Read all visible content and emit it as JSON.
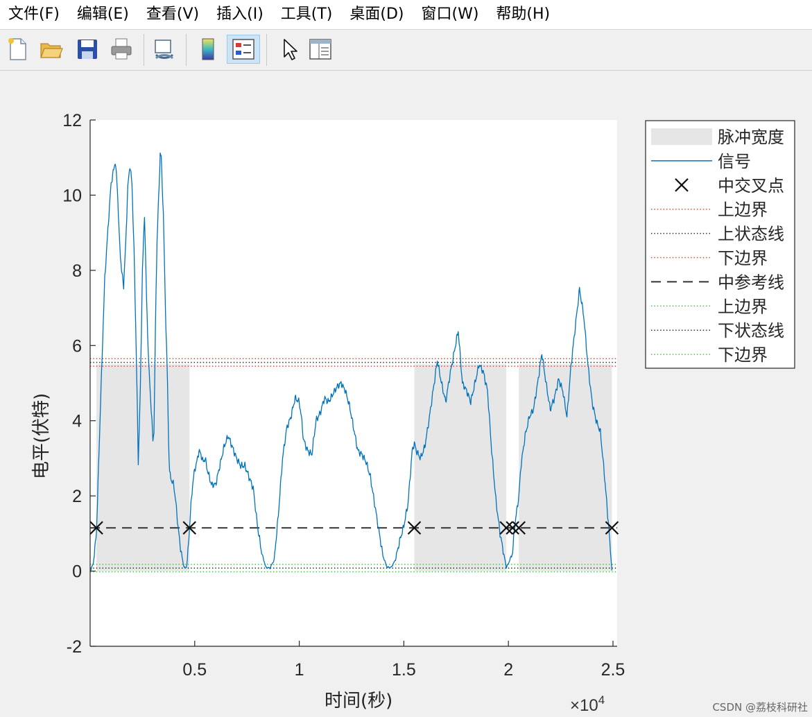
{
  "menu": [
    "文件(F)",
    "编辑(E)",
    "查看(V)",
    "插入(I)",
    "工具(T)",
    "桌面(D)",
    "窗口(W)",
    "帮助(H)"
  ],
  "toolbar": {
    "icons": [
      "new-file-icon",
      "open-folder-icon",
      "save-icon",
      "print-icon",
      "link-plot-icon",
      "colorbar-icon",
      "legend-icon",
      "pointer-icon",
      "property-inspector-icon"
    ]
  },
  "watermark": "CSDN @荔枝科研社",
  "colors": {
    "signal": "#0072bd",
    "pulse_fill": "#e6e6e6",
    "upper_bound_red": "#ff3333",
    "lower_bound_green": "#33cc33",
    "state_line": "#222222",
    "mid_ref": "#333333"
  },
  "chart_data": {
    "type": "line",
    "xlabel": "时间(秒)",
    "ylabel": "电平(伏特)",
    "x_exponent_label": "×10",
    "x_exponent_power": "4",
    "xlim": [
      0,
      25200
    ],
    "ylim": [
      -2,
      12
    ],
    "xticks": [
      5000,
      10000,
      15000,
      20000,
      25000
    ],
    "xtick_labels": [
      "0.5",
      "1",
      "1.5",
      "2",
      "2.5"
    ],
    "yticks": [
      -2,
      0,
      2,
      4,
      6,
      8,
      10,
      12
    ],
    "ytick_labels": [
      "-2",
      "0",
      "2",
      "4",
      "6",
      "8",
      "10",
      "12"
    ],
    "legend": [
      "脉冲宽度",
      "信号",
      "中交叉点",
      "上边界",
      "上状态线",
      "下边界",
      "中参考线",
      "上边界",
      "下状态线",
      "下边界"
    ],
    "legend_position": "outside-right",
    "pulse_width_regions": [
      [
        300,
        4750
      ],
      [
        15500,
        19900
      ],
      [
        20500,
        24950
      ]
    ],
    "pulse_region_top": 5.5,
    "signal": {
      "x": [
        0,
        150,
        300,
        500,
        700,
        900,
        1000,
        1200,
        1300,
        1400,
        1500,
        1600,
        1700,
        1800,
        1900,
        2000,
        2100,
        2200,
        2300,
        2400,
        2500,
        2600,
        2700,
        2800,
        2900,
        3000,
        3050,
        3100,
        3150,
        3200,
        3300,
        3350,
        3400,
        3500,
        3600,
        3700,
        3750,
        3800,
        3900,
        4000,
        4100,
        4200,
        4300,
        4400,
        4450,
        4500,
        4550,
        4600,
        4650,
        4700,
        4750,
        4800,
        4900,
        5000,
        5100,
        5200,
        5300,
        5400,
        5500,
        5600,
        5800,
        6000,
        6200,
        6400,
        6600,
        6800,
        7000,
        7200,
        7400,
        7600,
        7800,
        8000,
        8200,
        8400,
        8600,
        8800,
        9000,
        9200,
        9400,
        9600,
        9800,
        10000,
        10100,
        10200,
        10400,
        10600,
        10800,
        11000,
        11200,
        11400,
        11600,
        11800,
        12000,
        12200,
        12400,
        12600,
        12800,
        13000,
        13200,
        13400,
        13600,
        13800,
        14000,
        14200,
        14400,
        14600,
        14800,
        15000,
        15200,
        15300,
        15400,
        15500,
        15600,
        15800,
        16000,
        16200,
        16400,
        16600,
        16800,
        17000,
        17200,
        17400,
        17600,
        17800,
        18000,
        18200,
        18400,
        18600,
        18800,
        19000,
        19200,
        19400,
        19600,
        19800,
        19900,
        20000,
        20200,
        20300,
        20400,
        20500,
        20600,
        20800,
        21000,
        21200,
        21400,
        21600,
        21800,
        22000,
        22200,
        22400,
        22600,
        22800,
        23000,
        23200,
        23400,
        23600,
        23800,
        24000,
        24200,
        24400,
        24600,
        24800,
        24950,
        25100
      ],
      "y": [
        0.0,
        0.2,
        1.0,
        4.5,
        7.8,
        9.5,
        10.3,
        10.9,
        10.2,
        8.8,
        8.0,
        7.6,
        8.7,
        10.2,
        10.8,
        10.3,
        8.5,
        6.0,
        2.9,
        4.8,
        8.0,
        9.5,
        7.2,
        5.5,
        4.5,
        3.5,
        3.7,
        5.5,
        7.5,
        8.8,
        10.3,
        11.1,
        11.0,
        9.5,
        7.0,
        5.0,
        3.5,
        2.6,
        2.4,
        2.3,
        1.8,
        1.2,
        0.7,
        0.35,
        0.2,
        0.1,
        0.08,
        0.1,
        0.3,
        0.7,
        1.15,
        1.6,
        2.3,
        2.7,
        2.9,
        3.2,
        3.1,
        2.9,
        3.0,
        2.7,
        2.3,
        2.3,
        2.8,
        3.3,
        3.6,
        3.3,
        3.0,
        2.8,
        2.8,
        2.5,
        2.2,
        1.2,
        0.5,
        0.1,
        0.08,
        0.3,
        1.5,
        3.0,
        3.8,
        4.1,
        4.6,
        4.5,
        4.1,
        3.5,
        3.2,
        3.1,
        4.0,
        4.2,
        4.6,
        4.5,
        4.7,
        4.9,
        5.0,
        4.8,
        4.4,
        3.8,
        3.2,
        3.1,
        2.9,
        2.5,
        1.8,
        1.1,
        0.4,
        0.1,
        0.1,
        0.3,
        0.8,
        1.2,
        1.8,
        2.5,
        3.2,
        3.4,
        3.2,
        3.0,
        3.3,
        4.0,
        4.8,
        5.6,
        5.0,
        4.5,
        5.2,
        5.8,
        6.4,
        5.0,
        4.8,
        4.5,
        5.0,
        5.5,
        5.3,
        4.8,
        3.2,
        1.9,
        1.0,
        0.4,
        0.1,
        0.2,
        0.5,
        1.2,
        1.6,
        2.0,
        2.8,
        3.6,
        4.1,
        4.3,
        5.0,
        5.8,
        5.0,
        4.3,
        4.6,
        5.1,
        4.8,
        4.1,
        5.5,
        6.5,
        7.5,
        6.8,
        5.5,
        4.5,
        4.0,
        3.7,
        2.5,
        1.15,
        0.0
      ]
    },
    "cross_points": {
      "x": [
        300,
        4750,
        15500,
        19900,
        20200,
        20500,
        24950
      ],
      "y": [
        1.15,
        1.15,
        1.15,
        1.15,
        1.15,
        1.15,
        1.15
      ]
    },
    "upper_bound_1": 5.65,
    "upper_state_line": 5.55,
    "lower_bound_1": 5.45,
    "mid_reference": 1.15,
    "upper_bound_2": 0.18,
    "lower_state_line": 0.08,
    "lower_bound_2": -0.02
  }
}
